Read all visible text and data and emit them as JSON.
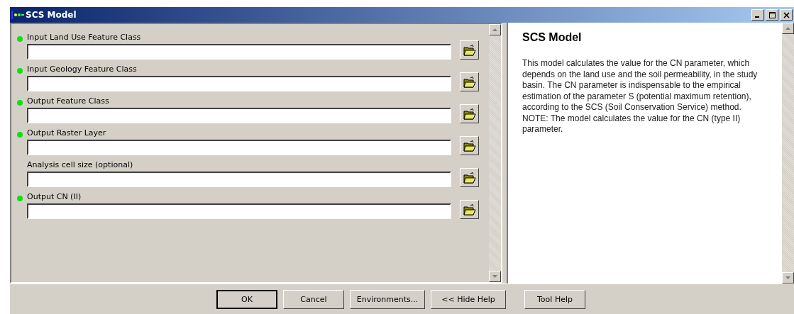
{
  "window": {
    "title": "SCS Model"
  },
  "parameters": [
    {
      "label": "Input Land Use Feature Class",
      "required": true
    },
    {
      "label": "Input Geology Feature Class",
      "required": true
    },
    {
      "label": "Output Feature Class",
      "required": true
    },
    {
      "label": "Output Raster Layer",
      "required": true
    },
    {
      "label": "Analysis cell size (optional)",
      "required": false
    },
    {
      "label": "Output CN (II)",
      "required": true
    }
  ],
  "help": {
    "title": "SCS Model",
    "text": "This model calculates the value for the CN parameter, which depends on the land use and the soil permeability, in the study basin. The CN parameter is indispensable to the empirical estimation of the parameter S (potential maximum retention), according to the SCS (Soil Conservation Service) method. NOTE: The model calculates the value for the CN (type II) parameter."
  },
  "buttons": [
    {
      "label": "OK",
      "default": true
    },
    {
      "label": "Cancel",
      "default": false
    },
    {
      "label": "Environments...",
      "default": false
    },
    {
      "label": "<< Hide Help",
      "default": false
    },
    {
      "label": "Tool Help",
      "default": false
    }
  ]
}
